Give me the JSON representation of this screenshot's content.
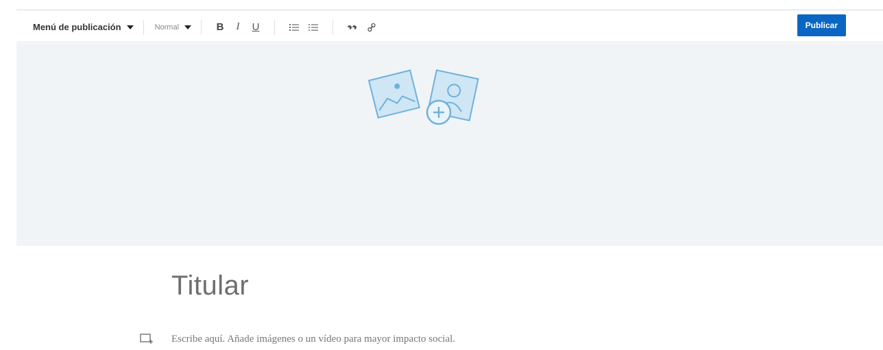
{
  "toolbar": {
    "publication_menu_label": "Menú de publicación",
    "text_style_label": "Normal",
    "bold_label": "B",
    "italic_label": "I",
    "underline_label": "U",
    "publish_label": "Publicar"
  },
  "cover": {
    "icons": [
      "landscape-image-icon",
      "add-circle-icon",
      "person-image-icon"
    ]
  },
  "editor": {
    "headline_placeholder": "Titular",
    "body_placeholder": "Escribe aquí. Añade imágenes o un vídeo para mayor impacto social."
  },
  "colors": {
    "accent": "#0a66c2",
    "cover_background": "#f1f4f7",
    "icon_blue": "#5aa9d6"
  }
}
